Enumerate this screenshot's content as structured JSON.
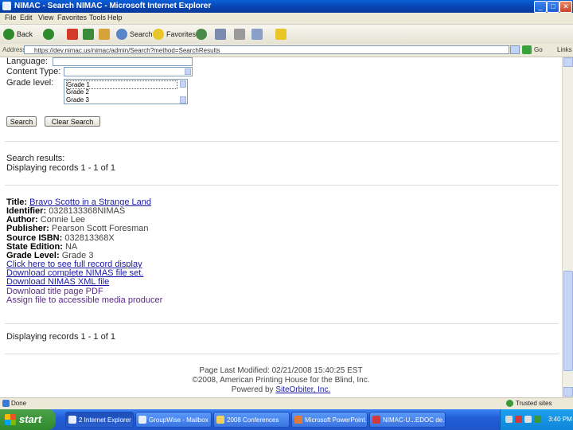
{
  "window": {
    "title": "NIMAC - Search NIMAC - Microsoft Internet Explorer",
    "min": "_",
    "max": "□",
    "close": "✕"
  },
  "menu": [
    "File",
    "Edit",
    "View",
    "Favorites",
    "Tools",
    "Help"
  ],
  "toolbar": {
    "back": "Back",
    "search": "Search",
    "favorites": "Favorites"
  },
  "address": {
    "label": "Address",
    "url": "https://dev.nimac.us/nimac/admin/Search?method=SearchResults",
    "go": "Go",
    "links": "Links"
  },
  "form": {
    "language_label": "Language:",
    "content_type_label": "Content Type:",
    "grade_level_label": "Grade level:",
    "grade_options": [
      "Grade 1",
      "Grade 2",
      "Grade 3"
    ],
    "search_button": "Search",
    "clear_button": "Clear Search"
  },
  "results": {
    "heading": "Search results:",
    "displaying_top": "Displaying records 1 - 1 of 1",
    "displaying_bottom": "Displaying records 1 - 1 of 1"
  },
  "record": {
    "title_label": "Title:",
    "title": "Bravo Scotto in a Strange Land",
    "identifier_label": "Identifier:",
    "identifier": "0328133368NIMAS",
    "author_label": "Author:",
    "author": "Connie Lee",
    "publisher_label": "Publisher:",
    "publisher": "Pearson Scott Foresman",
    "source_isbn_label": "Source ISBN:",
    "source_isbn": "032813368X",
    "state_edition_label": "State Edition:",
    "state_edition": "NA",
    "grade_level_label": "Grade Level:",
    "grade_level": "Grade 3",
    "link_full_record": "Click here to see full record display",
    "link_download_set": "Download complete NIMAS file set.",
    "link_download_xml": "Download NIMAS XML file",
    "link_download_pdf": "Download title page PDF",
    "link_assign": "Assign file to accessible media producer"
  },
  "footer": {
    "modified": "Page Last Modified: 02/21/2008 15:40:25 EST",
    "copyright": "©2008, American Printing House for the Blind, Inc.",
    "powered": "Powered by",
    "powered_link": "SiteOrbiter, Inc."
  },
  "status": {
    "text": "Done",
    "zone": "Trusted sites"
  },
  "taskbar": {
    "start": "start",
    "tasks": [
      "2 Internet Explorer",
      "GroupWise - Mailbox",
      "2008 Conferences",
      "Microsoft PowerPoint...",
      "NIMAC-U...EDOC de..."
    ],
    "clock": "3:40 PM"
  }
}
